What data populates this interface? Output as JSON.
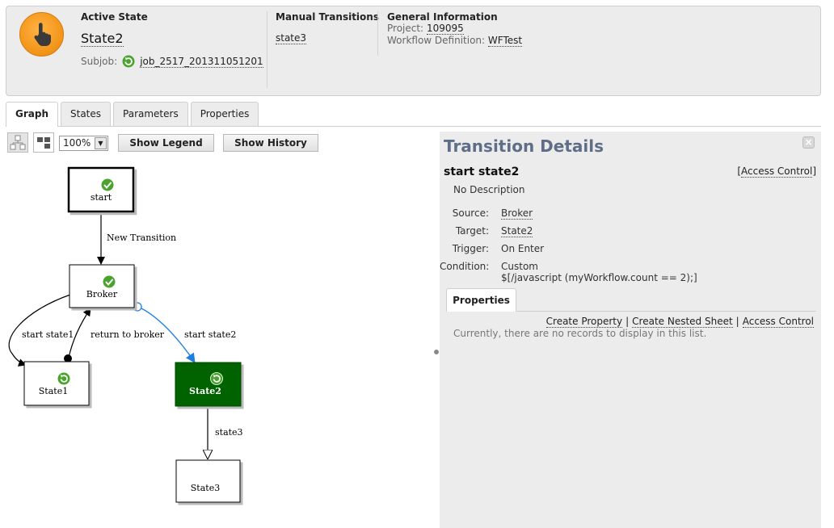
{
  "header": {
    "active_state_heading": "Active State",
    "state_name": "State2",
    "subjob_label": "Subjob:",
    "subjob_value": "job_2517_201311051201",
    "manual_heading": "Manual Transitions",
    "manual_items": [
      "state3"
    ],
    "general_heading": "General Information",
    "project_label": "Project:",
    "project_value": "109095",
    "workflow_label": "Workflow Definition:",
    "workflow_value": "WFTest"
  },
  "tabs": [
    {
      "label": "Graph",
      "active": true
    },
    {
      "label": "States",
      "active": false
    },
    {
      "label": "Parameters",
      "active": false
    },
    {
      "label": "Properties",
      "active": false
    }
  ],
  "toolbar": {
    "zoom": "100%",
    "show_legend": "Show Legend",
    "show_history": "Show History"
  },
  "graph": {
    "nodes": {
      "start": "start",
      "broker": "Broker",
      "state1": "State1",
      "state2": "State2",
      "state3": "State3"
    },
    "edges": {
      "new_transition": "New Transition",
      "start_state1": "start state1",
      "return_to_broker": "return to broker",
      "start_state2": "start state2",
      "state3": "state3"
    },
    "active_color": "#006400",
    "selected_edge_color": "#1f7fe0"
  },
  "details": {
    "title": "Transition Details",
    "transition_name": "start state2",
    "access_control_top": "Access Control",
    "description": "No Description",
    "source_label": "Source:",
    "source_value": "Broker",
    "target_label": "Target:",
    "target_value": "State2",
    "trigger_label": "Trigger:",
    "trigger_value": "On Enter",
    "condition_label": "Condition:",
    "condition_value": "Custom",
    "condition_expr": "$[/javascript (myWorkflow.count == 2);]",
    "properties_tab": "Properties",
    "create_property": "Create Property",
    "create_nested_sheet": "Create Nested Sheet",
    "access_control": "Access Control",
    "no_records": "Currently, there are no records to display in this list."
  }
}
